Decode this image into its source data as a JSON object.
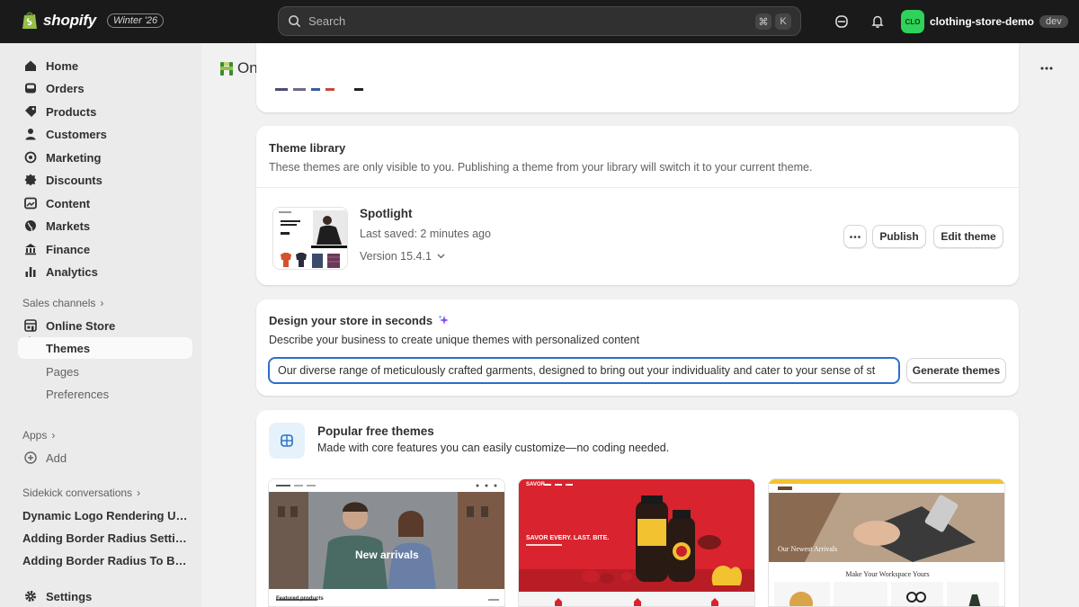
{
  "topbar": {
    "brand": "shopify",
    "season": "Winter '26",
    "search_placeholder": "Search",
    "shortcut_keys": [
      "⌘",
      "K"
    ],
    "store_avatar": "CLO",
    "store_name": "clothing-store-demo",
    "store_badge": "dev"
  },
  "sidebar": {
    "items": [
      {
        "label": "Home",
        "icon": "home-icon"
      },
      {
        "label": "Orders",
        "icon": "inbox-icon"
      },
      {
        "label": "Products",
        "icon": "tag-icon"
      },
      {
        "label": "Customers",
        "icon": "person-icon"
      },
      {
        "label": "Marketing",
        "icon": "target-icon"
      },
      {
        "label": "Discounts",
        "icon": "discount-icon"
      },
      {
        "label": "Content",
        "icon": "image-icon"
      },
      {
        "label": "Markets",
        "icon": "globe-icon"
      },
      {
        "label": "Finance",
        "icon": "bank-icon"
      },
      {
        "label": "Analytics",
        "icon": "chart-icon"
      }
    ],
    "sales_channels_label": "Sales channels",
    "online_store_label": "Online Store",
    "sub_items": [
      "Themes",
      "Pages",
      "Preferences"
    ],
    "apps_label": "Apps",
    "add_label": "Add",
    "sidekick_label": "Sidekick conversations",
    "conversations": [
      "Dynamic Logo Rendering Using Theme Settings",
      "Adding Border Radius Setting to Theme",
      "Adding Border Radius To Button"
    ],
    "settings_label": "Settings"
  },
  "main": {
    "title": "Online Store",
    "theme_library": {
      "title": "Theme library",
      "description": "These themes are only visible to you. Publishing a theme from your library will switch it to your current theme.",
      "theme_name": "Spotlight",
      "last_saved": "Last saved: 2 minutes ago",
      "version": "Version 15.4.1",
      "publish_label": "Publish",
      "edit_label": "Edit theme"
    },
    "design": {
      "title": "Design your store in seconds",
      "description": "Describe your business to create unique themes with personalized content",
      "prompt_value": "Our diverse range of meticulously crafted garments, designed to bring out your individuality and cater to your sense of st",
      "generate_label": "Generate themes"
    },
    "popular": {
      "title": "Popular free themes",
      "description": "Made with core features you can easily customize—no coding needed.",
      "themes": [
        {
          "caption": "New arrivals",
          "footer": "Featured products"
        },
        {
          "caption": "SAVOR EVERY. LAST. BITE.",
          "logo": "SAVOR"
        },
        {
          "caption": "Our Newest Arrivals",
          "sub": "Make Your Workspace Yours"
        }
      ]
    }
  },
  "colors": {
    "topbar": "#1a1a1a",
    "accent_green": "#2fd25a",
    "focus_blue": "#2c6ecb",
    "savor_red": "#d9232e"
  }
}
